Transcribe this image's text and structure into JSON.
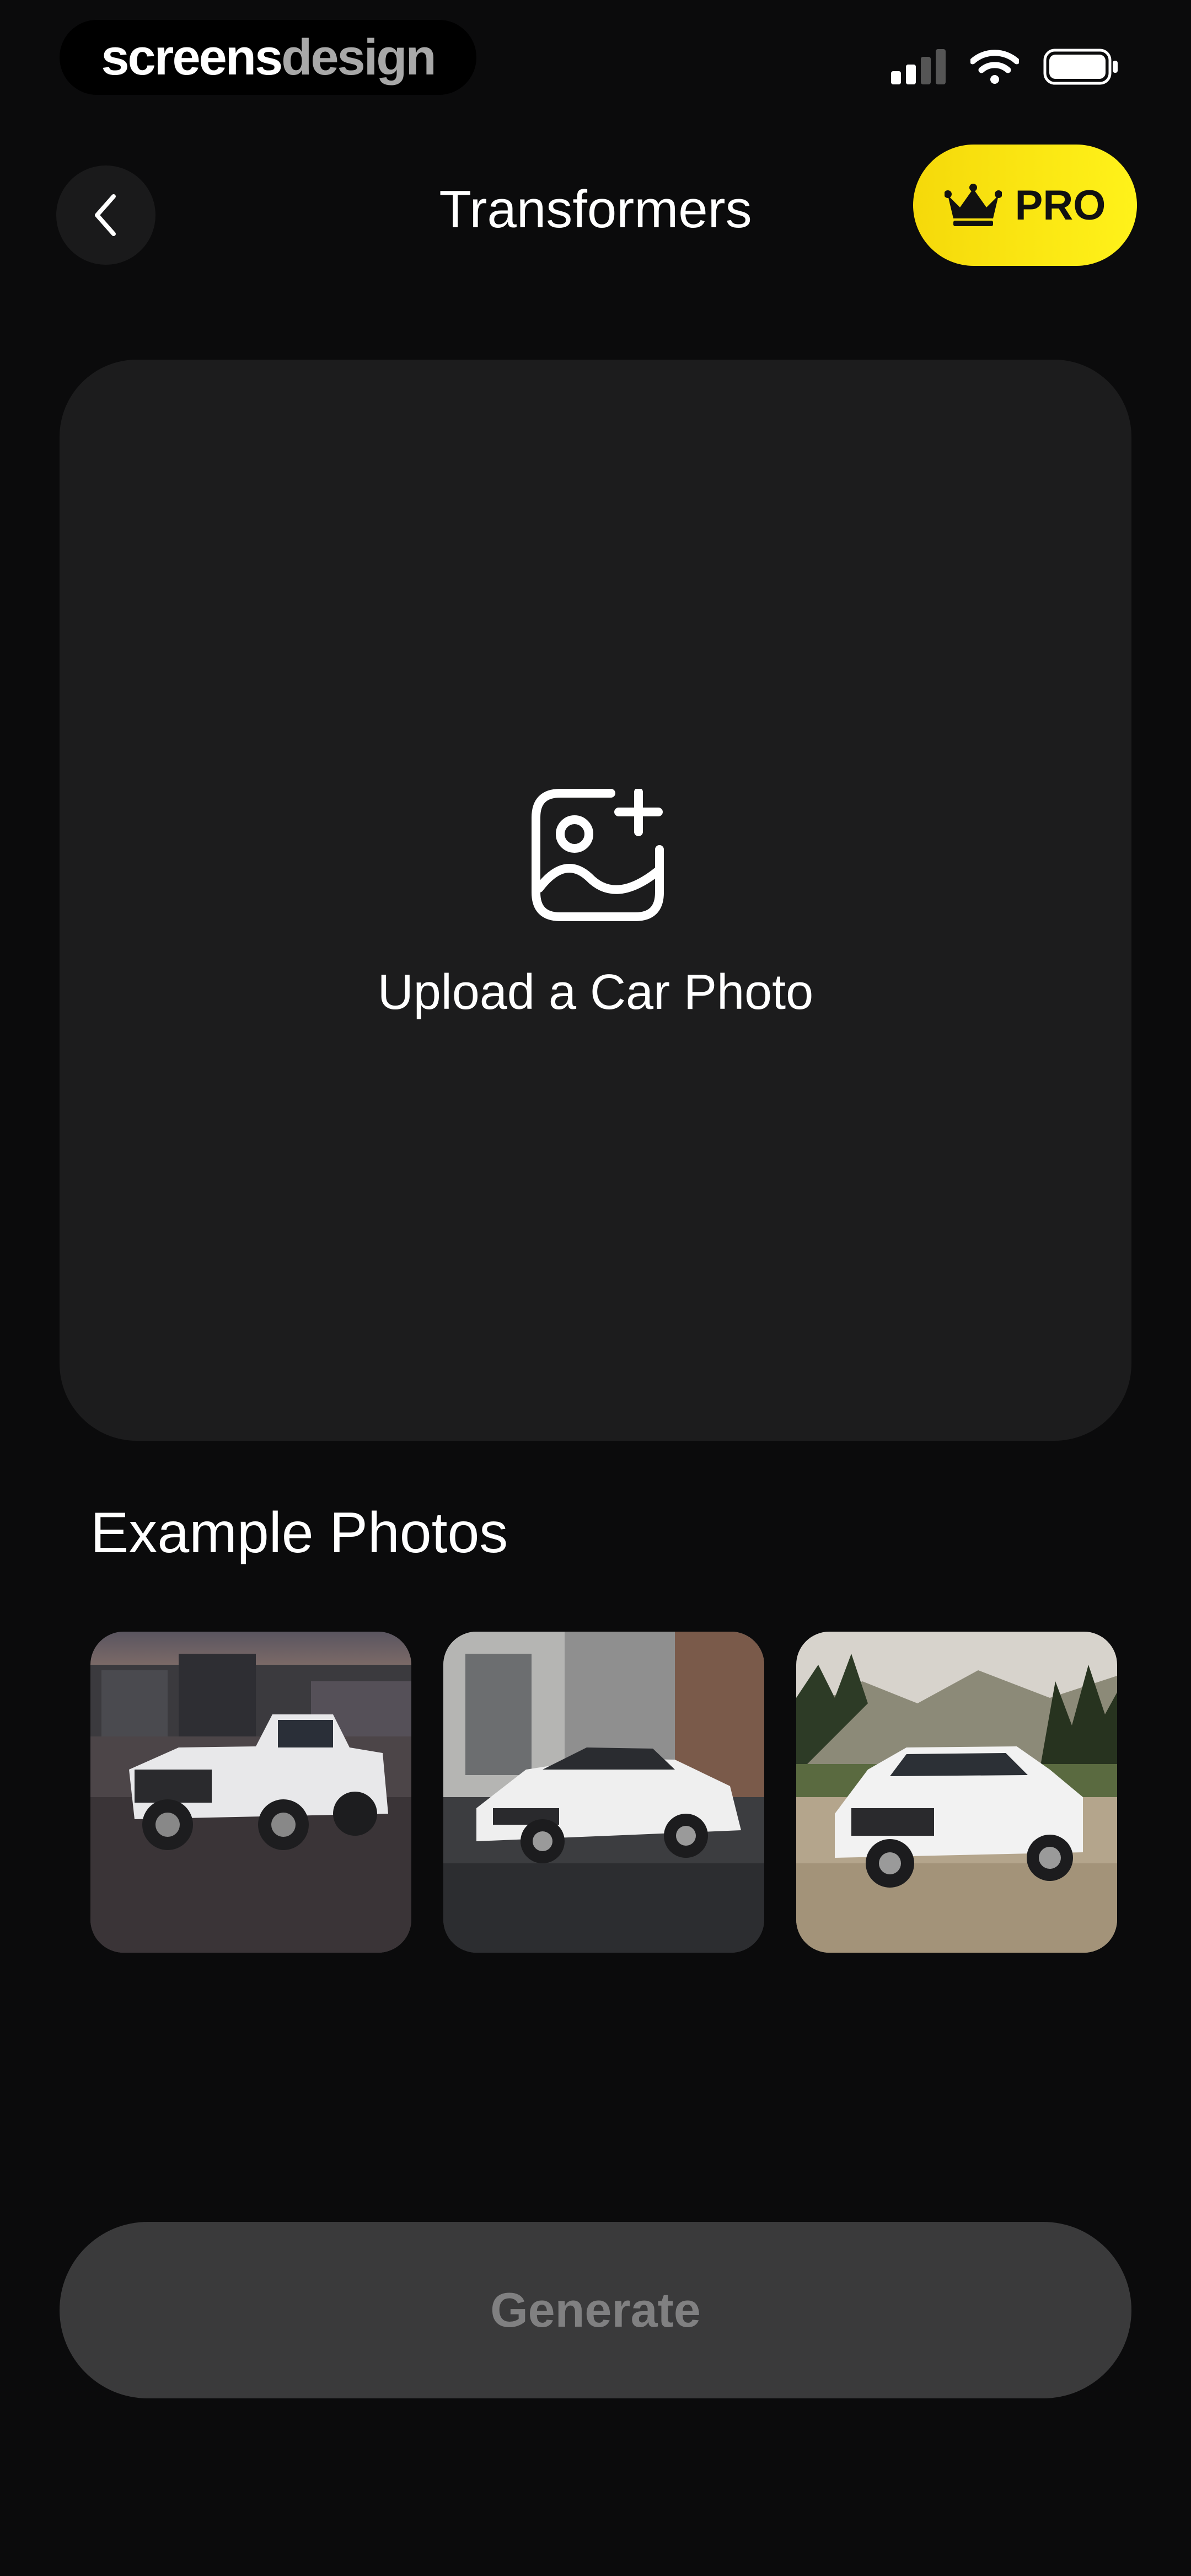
{
  "status_bar": {
    "brand_part1": "screens",
    "brand_part2": "design"
  },
  "header": {
    "title": "Transformers",
    "pro_label": "PRO",
    "back_icon": "chevron-left-icon",
    "pro_icon": "crown-icon"
  },
  "upload": {
    "label": "Upload a Car Photo",
    "icon": "image-add-icon"
  },
  "examples": {
    "title": "Example Photos",
    "items": [
      "white-pickup-truck",
      "white-sedan",
      "white-suv"
    ]
  },
  "footer": {
    "generate_label": "Generate"
  },
  "colors": {
    "background": "#0b0b0c",
    "card": "#1c1c1d",
    "pro_yellow": "#f5d90a",
    "button_disabled": "#3a3a3b",
    "button_disabled_text": "#808081"
  }
}
